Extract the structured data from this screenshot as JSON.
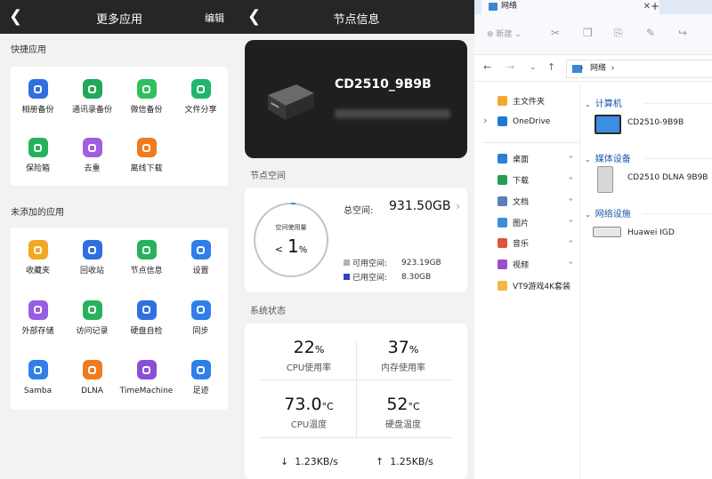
{
  "apps_panel": {
    "title": "更多应用",
    "edit_label": "编辑",
    "quick_label": "快捷应用",
    "quick_apps": [
      {
        "label": "相册备份",
        "icon": "photo-backup-icon",
        "color": "#2f6fe0"
      },
      {
        "label": "通讯录备份",
        "icon": "contacts-backup-icon",
        "color": "#22a85a"
      },
      {
        "label": "微信备份",
        "icon": "wechat-backup-icon",
        "color": "#2fbf5e"
      },
      {
        "label": "文件分享",
        "icon": "file-share-icon",
        "color": "#1fb56c"
      },
      {
        "label": "保险箱",
        "icon": "safe-icon",
        "color": "#24b25b"
      },
      {
        "label": "去重",
        "icon": "dedupe-icon",
        "color": "#a25de0"
      },
      {
        "label": "离线下载",
        "icon": "offline-download-icon",
        "color": "#f07a1e"
      }
    ],
    "more_label": "未添加的应用",
    "more_apps": [
      {
        "label": "收藏夹",
        "icon": "favorites-icon",
        "color": "#f5a623"
      },
      {
        "label": "回收站",
        "icon": "recycle-bin-icon",
        "color": "#2f6fe0"
      },
      {
        "label": "节点信息",
        "icon": "node-info-icon",
        "color": "#27b35d"
      },
      {
        "label": "设置",
        "icon": "settings-icon",
        "color": "#2f7fe8"
      },
      {
        "label": "外部存储",
        "icon": "external-storage-icon",
        "color": "#9a5ce0"
      },
      {
        "label": "访问记录",
        "icon": "access-log-icon",
        "color": "#27b35d"
      },
      {
        "label": "硬盘自检",
        "icon": "disk-check-icon",
        "color": "#2f6fe0"
      },
      {
        "label": "同步",
        "icon": "sync-icon",
        "color": "#2f7fe8"
      },
      {
        "label": "Samba",
        "icon": "samba-icon",
        "color": "#2f7fe8"
      },
      {
        "label": "DLNA",
        "icon": "dlna-icon",
        "color": "#f07a1e"
      },
      {
        "label": "TimeMachine",
        "icon": "time-machine-icon",
        "color": "#8a4fd6"
      },
      {
        "label": "足迹",
        "icon": "footprint-icon",
        "color": "#2f7fe8"
      }
    ]
  },
  "node_panel": {
    "title": "节点信息",
    "device_name": "CD2510_9B9B",
    "space_label": "节点空间",
    "ring_label": "空间使用量",
    "ring_prefix": "<",
    "ring_value": "1",
    "ring_unit": "%",
    "ring_fraction": 0.01,
    "total_label": "总空间:",
    "total_value": "931.50GB",
    "available_label": "可用空间:",
    "available_value": "923.19GB",
    "used_label": "已用空间:",
    "used_value": "8.30GB",
    "available_color": "#b3b3b3",
    "used_color": "#2f3fd6",
    "status_label": "系统状态",
    "cpu_value": "22",
    "cpu_unit": "%",
    "cpu_label": "CPU使用率",
    "mem_value": "37",
    "mem_unit": "%",
    "mem_label": "内存使用率",
    "cpu_temp_value": "73.0",
    "cpu_temp_unit": "°C",
    "cpu_temp_label": "CPU温度",
    "disk_temp_value": "52",
    "disk_temp_unit": "°C",
    "disk_temp_label": "硬盘温度",
    "down_speed": "1.23KB/s",
    "up_speed": "1.25KB/s"
  },
  "explorer": {
    "tab_title": "网络",
    "new_label": "新建",
    "address": "网络",
    "nav_items": [
      {
        "label": "主文件夹",
        "color": "#f0a830",
        "pinned": false
      },
      {
        "label": "OneDrive",
        "color": "#1e78d6",
        "pinned": false
      },
      {
        "label": "桌面",
        "color": "#2b7fd8",
        "pinned": true
      },
      {
        "label": "下载",
        "color": "#2a9a55",
        "pinned": true
      },
      {
        "label": "文档",
        "color": "#5a7fb8",
        "pinned": true
      },
      {
        "label": "图片",
        "color": "#3a8fd8",
        "pinned": true
      },
      {
        "label": "音乐",
        "color": "#e0533c",
        "pinned": true
      },
      {
        "label": "视频",
        "color": "#9a4fc8",
        "pinned": true
      },
      {
        "label": "VT9游戏4K套装",
        "color": "#f0b840",
        "pinned": false
      }
    ],
    "groups": [
      {
        "label": "计算机",
        "entries": [
          "CD2510-9B9B"
        ]
      },
      {
        "label": "媒体设备",
        "entries": [
          "CD2510 DLNA 9B9B"
        ]
      },
      {
        "label": "网络设施",
        "entries": [
          "Huawei IGD"
        ]
      }
    ]
  }
}
